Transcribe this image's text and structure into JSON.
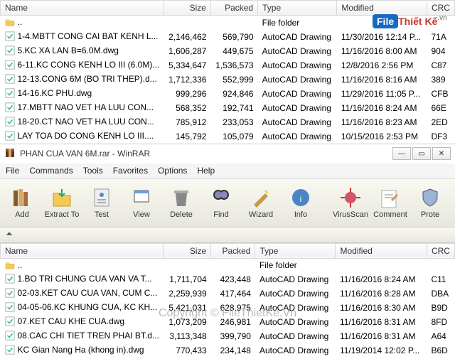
{
  "top_headers": {
    "name": "Name",
    "size": "Size",
    "packed": "Packed",
    "type": "Type",
    "modified": "Modified",
    "crc": "CRC"
  },
  "parent_row": {
    "type_label": "File folder"
  },
  "top_files": [
    {
      "name": "1-4.MBTT CONG CAI BAT KENH L...",
      "size": "2,146,462",
      "packed": "569,790",
      "type": "AutoCAD Drawing",
      "mod": "11/30/2016 12:14 P...",
      "crc": "71A"
    },
    {
      "name": "5.KC XA LAN B=6.0M.dwg",
      "size": "1,606,287",
      "packed": "449,675",
      "type": "AutoCAD Drawing",
      "mod": "11/16/2016 8:00 AM",
      "crc": "904"
    },
    {
      "name": "6-11.KC CONG KENH LO III (6.0M)...",
      "size": "5,334,647",
      "packed": "1,536,573",
      "type": "AutoCAD Drawing",
      "mod": "12/8/2016 2:56 PM",
      "crc": "C87"
    },
    {
      "name": "12-13.CONG 6M (BO TRI THEP).d...",
      "size": "1,712,336",
      "packed": "552,999",
      "type": "AutoCAD Drawing",
      "mod": "11/16/2016 8:16 AM",
      "crc": "389"
    },
    {
      "name": "14-16.KC PHU.dwg",
      "size": "999,296",
      "packed": "924,846",
      "type": "AutoCAD Drawing",
      "mod": "11/29/2016 11:05 P...",
      "crc": "CFB"
    },
    {
      "name": "17.MBTT NAO VET HA LUU CON...",
      "size": "568,352",
      "packed": "192,741",
      "type": "AutoCAD Drawing",
      "mod": "11/16/2016 8:24 AM",
      "crc": "66E"
    },
    {
      "name": "18-20.CT NAO VET HA LUU CON...",
      "size": "785,912",
      "packed": "233,053",
      "type": "AutoCAD Drawing",
      "mod": "11/16/2016 8:23 AM",
      "crc": "2ED"
    },
    {
      "name": "LAY  TOA DO CONG KENH LO III....",
      "size": "145,792",
      "packed": "105,079",
      "type": "AutoCAD Drawing",
      "mod": "10/15/2016 2:53 PM",
      "crc": "DF3"
    }
  ],
  "window": {
    "title": "PHAN CUA VAN 6M.rar - WinRAR"
  },
  "menus": {
    "file": "File",
    "commands": "Commands",
    "tools": "Tools",
    "favorites": "Favorites",
    "options": "Options",
    "help": "Help"
  },
  "toolbar": {
    "add": "Add",
    "extract": "Extract To",
    "test": "Test",
    "view": "View",
    "delete": "Delete",
    "find": "Find",
    "wizard": "Wizard",
    "info": "Info",
    "virus": "VirusScan",
    "comment": "Comment",
    "protect": "Prote"
  },
  "bot_headers": {
    "name": "Name",
    "size": "Size",
    "packed": "Packed",
    "type": "Type",
    "modified": "Modified",
    "crc": "CRC"
  },
  "bot_files": [
    {
      "name": "1.BO TRI CHUNG CUA VAN VA T...",
      "size": "1,711,704",
      "packed": "423,448",
      "type": "AutoCAD Drawing",
      "mod": "11/16/2016 8:24 AM",
      "crc": "C11"
    },
    {
      "name": "02-03.KET CAU CUA VAN, CUM C...",
      "size": "2,259,939",
      "packed": "417,464",
      "type": "AutoCAD Drawing",
      "mod": "11/16/2016 8:28 AM",
      "crc": "DBA"
    },
    {
      "name": "04-05-06.KC KHUNG CUA, KC KH...",
      "size": "5,421,031",
      "packed": "628,975",
      "type": "AutoCAD Drawing",
      "mod": "11/16/2016 8:30 AM",
      "crc": "B9D"
    },
    {
      "name": "07.KET CAU KHE CUA.dwg",
      "size": "1,073,209",
      "packed": "246,981",
      "type": "AutoCAD Drawing",
      "mod": "11/16/2016 8:31 AM",
      "crc": "8FD"
    },
    {
      "name": "08.CAC CHI TIET TREN PHAI BT.d...",
      "size": "3,113,348",
      "packed": "399,790",
      "type": "AutoCAD Drawing",
      "mod": "11/16/2016 8:31 AM",
      "crc": "A64"
    },
    {
      "name": "KC Gian Nang Ha (khong in).dwg",
      "size": "770,433",
      "packed": "234,148",
      "type": "AutoCAD Drawing",
      "mod": "11/19/2014 12:02 P...",
      "crc": "B6D"
    }
  ],
  "overlay": {
    "copyright": "Copyright © FileThietKe.Vn",
    "logo_box": "File",
    "logo_tk": "Thiết Kế",
    "logo_vn": ".vn"
  }
}
